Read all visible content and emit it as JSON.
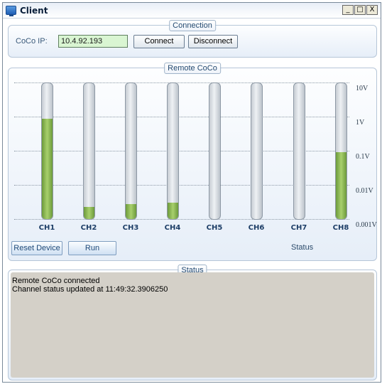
{
  "window": {
    "title": "Client",
    "controls": {
      "minimize": "_",
      "maximize": "□",
      "close": "X"
    }
  },
  "connection": {
    "legend": "Connection",
    "ip_label": "CoCo IP:",
    "ip_value": "10.4.92.193",
    "connect_label": "Connect",
    "disconnect_label": "Disconnect"
  },
  "remote": {
    "legend": "Remote CoCo",
    "reset_label": "Reset Device",
    "run_label": "Run",
    "status_label": "Status",
    "scale_labels": [
      "10V",
      "1V",
      "0.1V",
      "0.01V",
      "0.001V"
    ],
    "channels": [
      {
        "name": "CH1",
        "level": 0.74
      },
      {
        "name": "CH2",
        "level": 0.09
      },
      {
        "name": "CH3",
        "level": 0.11
      },
      {
        "name": "CH4",
        "level": 0.12
      },
      {
        "name": "CH5",
        "level": 0
      },
      {
        "name": "CH6",
        "level": 0
      },
      {
        "name": "CH7",
        "level": 0
      },
      {
        "name": "CH8",
        "level": 0.49
      }
    ]
  },
  "status": {
    "legend": "Status",
    "log": [
      "Remote CoCo connected",
      "Channel status updated at 11:49:32.3906250"
    ]
  }
}
